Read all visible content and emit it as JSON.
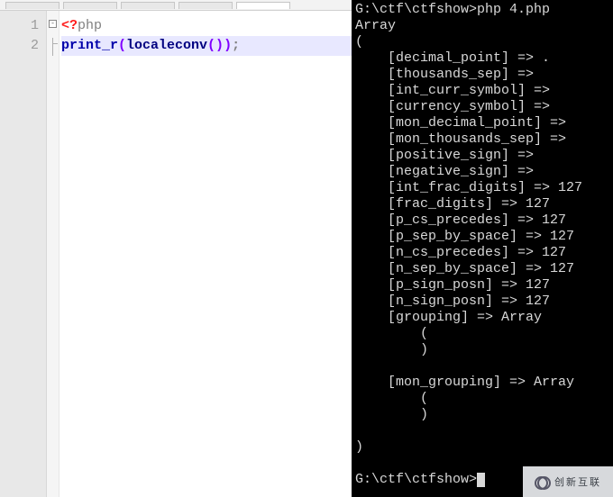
{
  "editor": {
    "lines": [
      {
        "num": "1",
        "tokens": [
          {
            "cls": "tok-delim",
            "t": "<?"
          },
          {
            "cls": "tok-meta",
            "t": "php"
          }
        ],
        "current": false
      },
      {
        "num": "2",
        "tokens": [
          {
            "cls": "tok-func",
            "t": "print_r"
          },
          {
            "cls": "tok-paren",
            "t": "("
          },
          {
            "cls": "tok-name",
            "t": "localeconv"
          },
          {
            "cls": "tok-paren",
            "t": "()"
          },
          {
            "cls": "tok-paren",
            "t": ")"
          },
          {
            "cls": "tok-punct",
            "t": ";"
          }
        ],
        "current": true
      }
    ],
    "fold_box_glyph": "-"
  },
  "terminal": {
    "command_line": "G:\\ctf\\ctfshow>php 4.php",
    "output_header": "Array",
    "open_paren": "(",
    "entries": [
      {
        "key": "decimal_point",
        "value": "."
      },
      {
        "key": "thousands_sep",
        "value": ""
      },
      {
        "key": "int_curr_symbol",
        "value": ""
      },
      {
        "key": "currency_symbol",
        "value": ""
      },
      {
        "key": "mon_decimal_point",
        "value": ""
      },
      {
        "key": "mon_thousands_sep",
        "value": ""
      },
      {
        "key": "positive_sign",
        "value": ""
      },
      {
        "key": "negative_sign",
        "value": ""
      },
      {
        "key": "int_frac_digits",
        "value": "127"
      },
      {
        "key": "frac_digits",
        "value": "127"
      },
      {
        "key": "p_cs_precedes",
        "value": "127"
      },
      {
        "key": "p_sep_by_space",
        "value": "127"
      },
      {
        "key": "n_cs_precedes",
        "value": "127"
      },
      {
        "key": "n_sep_by_space",
        "value": "127"
      },
      {
        "key": "p_sign_posn",
        "value": "127"
      },
      {
        "key": "n_sign_posn",
        "value": "127"
      }
    ],
    "nested_arrays": [
      {
        "key": "grouping",
        "label": "Array"
      },
      {
        "key": "mon_grouping",
        "label": "Array"
      }
    ],
    "close_paren": ")",
    "prompt_after": "G:\\ctf\\ctfshow>"
  },
  "watermark": {
    "text": "创新互联"
  }
}
